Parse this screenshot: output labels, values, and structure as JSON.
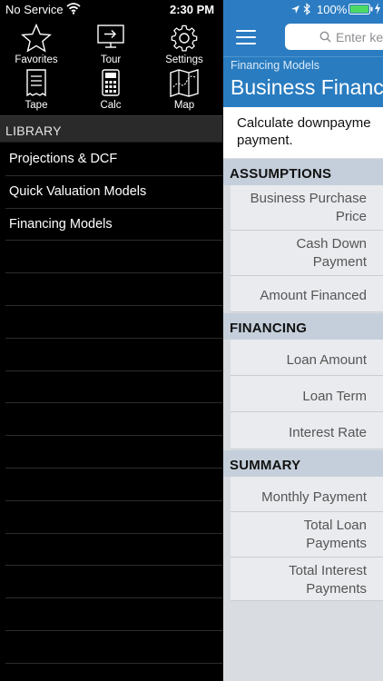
{
  "status_bar": {
    "carrier": "No Service",
    "time": "2:30 PM",
    "battery": "100%"
  },
  "toolbar": {
    "favorites_label": "Favorites",
    "tour_label": "Tour",
    "settings_label": "Settings",
    "tape_label": "Tape",
    "calc_label": "Calc",
    "map_label": "Map"
  },
  "library": {
    "header": "LIBRARY",
    "items": [
      {
        "label": "Projections & DCF"
      },
      {
        "label": "Quick Valuation Models"
      },
      {
        "label": "Financing Models"
      }
    ]
  },
  "search": {
    "placeholder": "Enter ke"
  },
  "model": {
    "breadcrumb": "Financing Models",
    "title": "Business Financ",
    "description": "Calculate downpayme\npayment."
  },
  "sections": {
    "assumptions": {
      "title": "ASSUMPTIONS",
      "fields": [
        {
          "label": "Business Purchase\nPrice"
        },
        {
          "label": "Cash Down\nPayment"
        },
        {
          "label": "Amount Financed"
        }
      ]
    },
    "financing": {
      "title": "FINANCING",
      "fields": [
        {
          "label": "Loan Amount"
        },
        {
          "label": "Loan Term"
        },
        {
          "label": "Interest Rate"
        }
      ]
    },
    "summary": {
      "title": "SUMMARY",
      "fields": [
        {
          "label": "Monthly Payment"
        },
        {
          "label": "Total Loan\nPayments"
        },
        {
          "label": "Total Interest\nPayments"
        }
      ]
    }
  },
  "colors": {
    "accent_blue": "#2b7cc2",
    "section_header": "#c5cfdb",
    "sidebar_bg": "#000000"
  },
  "icons": [
    "star-icon",
    "tour-icon",
    "gear-icon",
    "tape-icon",
    "calculator-icon",
    "map-icon",
    "hamburger-icon",
    "search-icon",
    "wifi-icon",
    "location-icon",
    "bluetooth-icon",
    "battery-icon",
    "charging-icon"
  ]
}
